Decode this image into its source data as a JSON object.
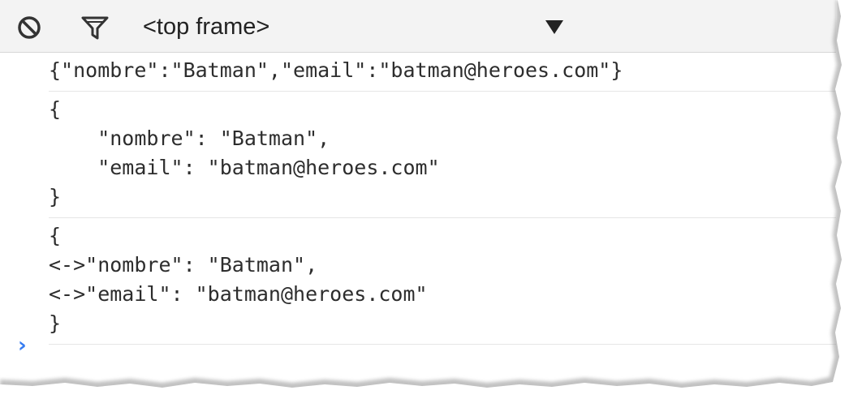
{
  "toolbar": {
    "clear_icon": "clear-console-icon",
    "filter_icon": "filter-icon",
    "context_selector": {
      "selected": "<top frame>",
      "arrow_icon": "dropdown-arrow-icon"
    }
  },
  "console": {
    "messages": [
      {
        "lines": [
          "{\"nombre\":\"Batman\",\"email\":\"batman@heroes.com\"}"
        ]
      },
      {
        "lines": [
          "{",
          "    \"nombre\": \"Batman\",",
          "    \"email\": \"batman@heroes.com\"",
          "}"
        ]
      },
      {
        "lines": [
          "{",
          "<->\"nombre\": \"Batman\",",
          "<->\"email\": \"batman@heroes.com\"",
          "}"
        ]
      }
    ],
    "prompt_symbol": "›",
    "input_value": ""
  },
  "colors": {
    "toolbar_bg": "#f3f3f3",
    "text": "#2d2d2d",
    "prompt": "#367cf1",
    "divider": "#e6e6e6",
    "icon": "#333333"
  }
}
